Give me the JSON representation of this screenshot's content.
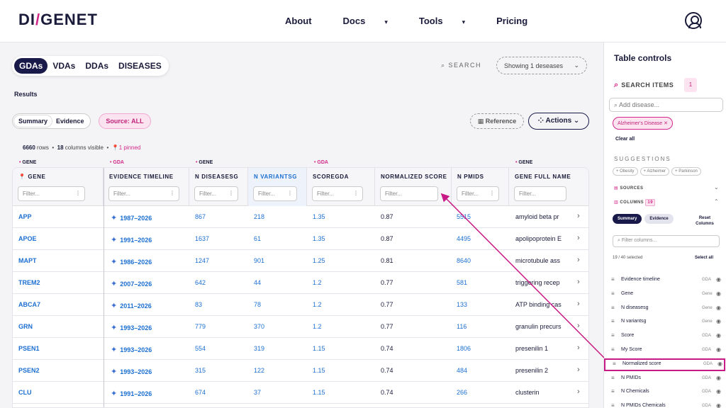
{
  "logo": {
    "part1": "DI",
    "part2": "GENET"
  },
  "nav": [
    {
      "label": "About"
    },
    {
      "label": "Docs",
      "chev": "▾"
    },
    {
      "label": "Tools",
      "chev": "▾"
    },
    {
      "label": "Pricing"
    }
  ],
  "tabs": [
    "GDAs",
    "VDAs",
    "DDAs",
    "DISEASES"
  ],
  "search_label": "SEARCH",
  "showing": "Showing 1 deseases",
  "results_label": "Results",
  "segment": [
    "Summary",
    "Evidence"
  ],
  "source_btn": "Source: ALL",
  "reference_btn": "Reference",
  "actions_btn": "Actions",
  "meta": {
    "rows": "6660",
    "rows_label": "rows",
    "cols": "18",
    "cols_label": "columns visible",
    "pinned": "1 pinned"
  },
  "group_headers": {
    "gene": "GENE",
    "gda": "GDA"
  },
  "columns": [
    {
      "label": "GENE",
      "filter": "Filter..."
    },
    {
      "label": "EVIDENCE TIMELINE",
      "filter": "Filter..."
    },
    {
      "label": "N DISEASESG",
      "filter": "Filter..."
    },
    {
      "label": "N VARIANTSG",
      "filter": "Filter..."
    },
    {
      "label": "SCOREGDA",
      "filter": "Filter..."
    },
    {
      "label": "NORMALIZED SCORE",
      "filter": "Filter..."
    },
    {
      "label": "N PMIDS",
      "filter": "Filter..."
    },
    {
      "label": "GENE FULL NAME",
      "filter": "Filter..."
    }
  ],
  "rows": [
    {
      "gene": "APP",
      "timeline": "1987–2026",
      "ndis": "867",
      "nvar": "218",
      "score": "1.35",
      "norm": "0.87",
      "pmids": "5515",
      "full": "amyloid beta pr"
    },
    {
      "gene": "APOE",
      "timeline": "1991–2026",
      "ndis": "1637",
      "nvar": "61",
      "score": "1.35",
      "norm": "0.87",
      "pmids": "4495",
      "full": "apolipoprotein E"
    },
    {
      "gene": "MAPT",
      "timeline": "1986–2026",
      "ndis": "1247",
      "nvar": "901",
      "score": "1.25",
      "norm": "0.81",
      "pmids": "8640",
      "full": "microtubule ass"
    },
    {
      "gene": "TREM2",
      "timeline": "2007–2026",
      "ndis": "642",
      "nvar": "44",
      "score": "1.2",
      "norm": "0.77",
      "pmids": "581",
      "full": "triggering recep"
    },
    {
      "gene": "ABCA7",
      "timeline": "2011–2026",
      "ndis": "83",
      "nvar": "78",
      "score": "1.2",
      "norm": "0.77",
      "pmids": "133",
      "full": "ATP binding cas"
    },
    {
      "gene": "GRN",
      "timeline": "1993–2026",
      "ndis": "779",
      "nvar": "370",
      "score": "1.2",
      "norm": "0.77",
      "pmids": "116",
      "full": "granulin precurs"
    },
    {
      "gene": "PSEN1",
      "timeline": "1993–2026",
      "ndis": "554",
      "nvar": "319",
      "score": "1.15",
      "norm": "0.74",
      "pmids": "1806",
      "full": "presenilin 1"
    },
    {
      "gene": "PSEN2",
      "timeline": "1993–2026",
      "ndis": "315",
      "nvar": "122",
      "score": "1.15",
      "norm": "0.74",
      "pmids": "484",
      "full": "presenilin 2"
    },
    {
      "gene": "CLU",
      "timeline": "1991–2026",
      "ndis": "674",
      "nvar": "37",
      "score": "1.15",
      "norm": "0.74",
      "pmids": "266",
      "full": "clusterin"
    }
  ],
  "panel": {
    "title": "Table controls",
    "search_items": "SEARCH ITEMS",
    "badge": "1",
    "add_placeholder": "Add disease...",
    "chip": "Alzheimer's Disease",
    "clear_all": "Clear all",
    "suggestions": "SUGGESTIONS",
    "sugg_chips": [
      "+ Obesity",
      "+ Alzheimer",
      "+ Parkinson"
    ],
    "sources": "SOURCES",
    "columns": "COLUMNS",
    "columns_badge": "19",
    "seg": [
      "Summary",
      "Evidence"
    ],
    "reset": "Reset Columns",
    "filter_placeholder": "Filter columns...",
    "count": "19 / 40 selected",
    "select_all": "Select all",
    "items": [
      {
        "name": "Evidence timeline",
        "tag": "GDA"
      },
      {
        "name": "Gene",
        "tag": "Gene"
      },
      {
        "name": "N diseasesg",
        "tag": "Gene"
      },
      {
        "name": "N variantsg",
        "tag": "Gene"
      },
      {
        "name": "Score",
        "tag": "GDA"
      },
      {
        "name": "My Score",
        "tag": "GDA"
      },
      {
        "name": "Normalized score",
        "tag": "GDA"
      },
      {
        "name": "N PMIDs",
        "tag": "GDA"
      },
      {
        "name": "N Chemicals",
        "tag": "GDA"
      },
      {
        "name": "N PMIDs Chemicals",
        "tag": "GDA"
      }
    ]
  }
}
